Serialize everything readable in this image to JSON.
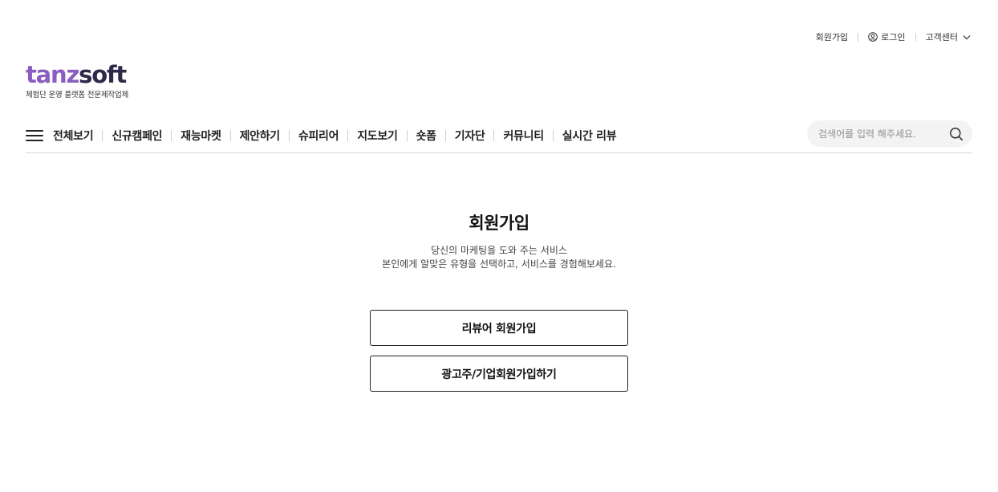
{
  "util": {
    "signup": "회원가입",
    "login": "로그인",
    "support": "고객센터"
  },
  "logo": {
    "part1": "tanz",
    "part2": "soft",
    "tagline": "체험단 운영 플랫폼 전문제작업체",
    "colors": {
      "part1": "#8a5ec1",
      "part2": "#2d2a4a"
    }
  },
  "nav": {
    "items": [
      {
        "label": "전체보기"
      },
      {
        "label": "신규캠페인"
      },
      {
        "label": "재능마켓"
      },
      {
        "label": "제안하기"
      },
      {
        "label": "슈피리어"
      },
      {
        "label": "지도보기"
      },
      {
        "label": "숏폼"
      },
      {
        "label": "기자단"
      },
      {
        "label": "커뮤니티"
      },
      {
        "label": "실시간 리뷰"
      }
    ]
  },
  "search": {
    "placeholder": "검색어를 입력 해주세요.",
    "value": ""
  },
  "main": {
    "title": "회원가입",
    "desc_line1": "당신의 마케팅을 도와 주는 서비스",
    "desc_line2": "본인에게 알맞은 유형을 선택하고, 서비스를 경험해보세요.",
    "reviewer_button": "리뷰어 회원가입",
    "advertiser_button": "광고주/기업회원가입하기"
  }
}
